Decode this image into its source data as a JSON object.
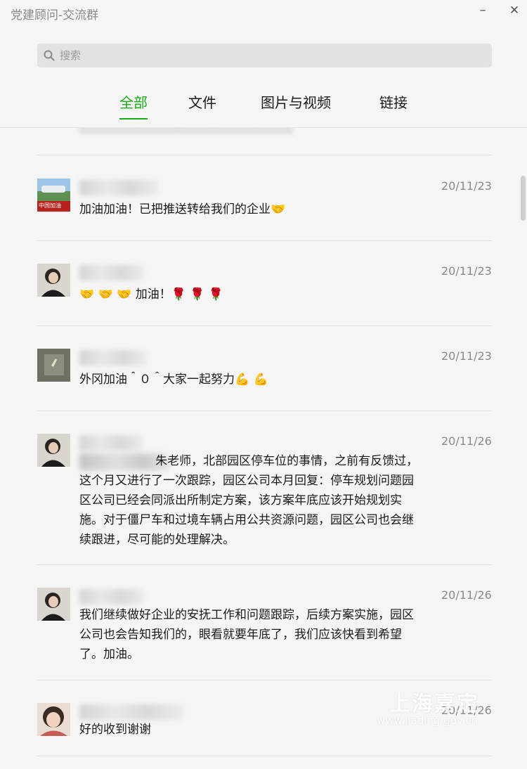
{
  "window": {
    "title": "党建顾问-交流群",
    "minimize_glyph": "–",
    "close_glyph": "✕"
  },
  "search": {
    "placeholder": "搜索",
    "value": ""
  },
  "tabs": [
    {
      "label": "全部",
      "active": true
    },
    {
      "label": "文件",
      "active": false
    },
    {
      "label": "图片与视频",
      "active": false
    },
    {
      "label": "链接",
      "active": false
    }
  ],
  "messages": [
    {
      "date": "20/11/23",
      "text": "加油加油！已把推送转给我们的企业🤝",
      "avatar_caption": "中国加油"
    },
    {
      "date": "20/11/23",
      "text": "🤝 🤝 🤝 加油！🌹 🌹 🌹"
    },
    {
      "date": "20/11/23",
      "text": "外冈加油＾０＾大家一起努力💪 💪"
    },
    {
      "date": "20/11/26",
      "text": "                    朱老师，北部园区停车位的事情，之前有反馈过，这个月又进行了一次跟踪，园区公司本月回复：停车规划问题园区公司已经会同派出所制定方案，该方案年底应该开始规划实施。对于僵尸车和过境车辆占用公共资源问题，园区公司也会继续跟进，尽可能的处理解决。"
    },
    {
      "date": "20/11/26",
      "text": "我们继续做好企业的安抚工作和问题跟踪，后续方案实施，园区公司也会告知我们的，眼看就要年底了，我们应该快看到希望了。加油。"
    },
    {
      "date": "20/11/26",
      "text": "好的收到谢谢"
    }
  ],
  "watermark": {
    "main": "上海嘉定",
    "url": "www.jiading.gov.cn"
  },
  "colors": {
    "accent": "#1aad19",
    "background": "#f5f5f5",
    "date": "#8a8a8a",
    "divider": "#e4e4e4"
  }
}
